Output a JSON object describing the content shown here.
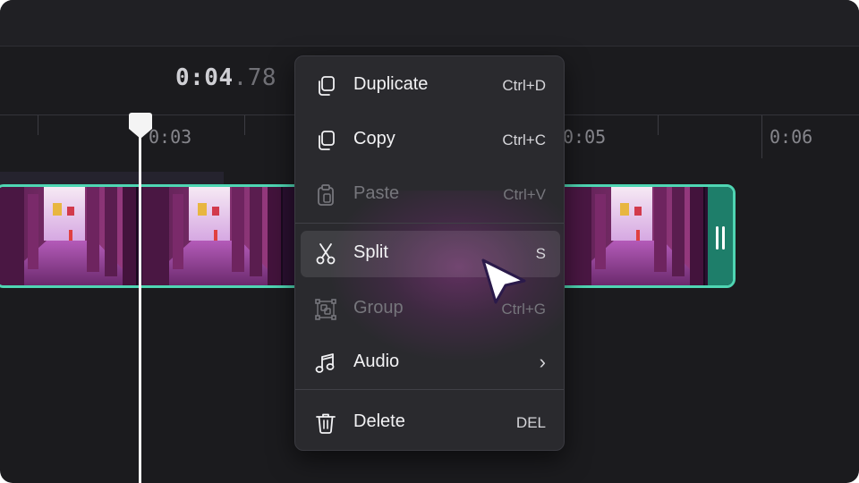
{
  "timecode": {
    "main": "0:04",
    "fraction": ".78"
  },
  "ruler": {
    "labels": [
      "0:03",
      "0:05",
      "0:06"
    ]
  },
  "context_menu": {
    "items": [
      {
        "label": "Duplicate",
        "shortcut": "Ctrl+D",
        "icon": "duplicate-icon",
        "enabled": true
      },
      {
        "label": "Copy",
        "shortcut": "Ctrl+C",
        "icon": "copy-icon",
        "enabled": true
      },
      {
        "label": "Paste",
        "shortcut": "Ctrl+V",
        "icon": "paste-icon",
        "enabled": false
      },
      {
        "label": "Split",
        "shortcut": "S",
        "icon": "scissors-icon",
        "enabled": true,
        "hovered": true
      },
      {
        "label": "Group",
        "shortcut": "Ctrl+G",
        "icon": "group-icon",
        "enabled": false
      },
      {
        "label": "Audio",
        "shortcut": "›",
        "icon": "music-note-icon",
        "enabled": true,
        "submenu": true
      },
      {
        "label": "Delete",
        "shortcut": "DEL",
        "icon": "trash-icon",
        "enabled": true
      }
    ]
  },
  "colors": {
    "background": "#1b1b1e",
    "clip_border": "#4fd6b3",
    "menu_bg": "#2a2a2e",
    "playhead": "#f4f4f4"
  }
}
